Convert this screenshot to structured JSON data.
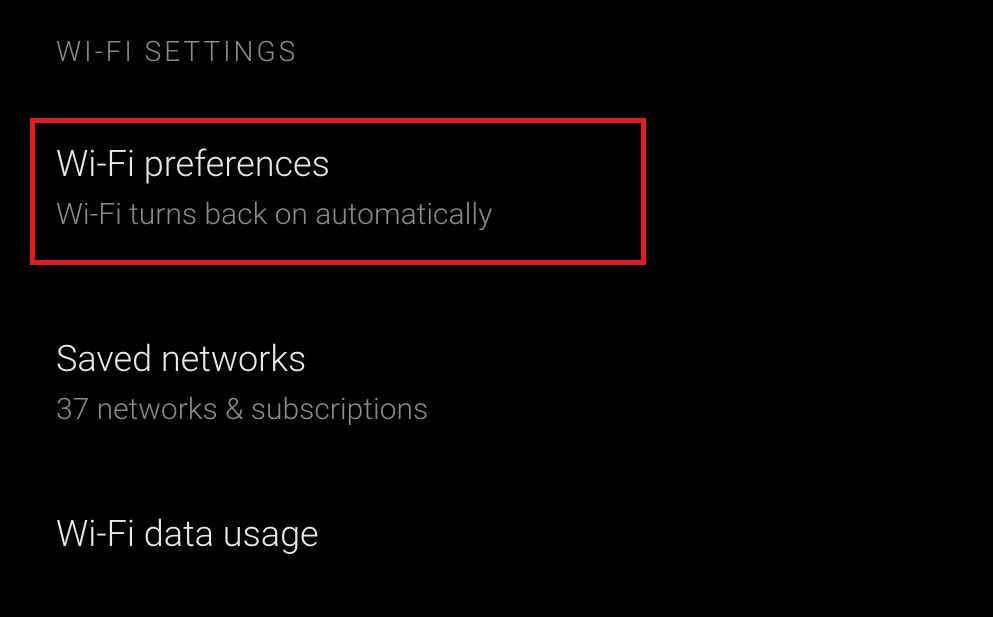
{
  "section": {
    "header": "WI-FI SETTINGS"
  },
  "items": [
    {
      "title": "Wi-Fi preferences",
      "subtitle": "Wi-Fi turns back on automatically"
    },
    {
      "title": "Saved networks",
      "subtitle": "37 networks & subscriptions"
    },
    {
      "title": "Wi-Fi data usage",
      "subtitle": ""
    }
  ],
  "highlight": {
    "color": "#e31b23"
  }
}
